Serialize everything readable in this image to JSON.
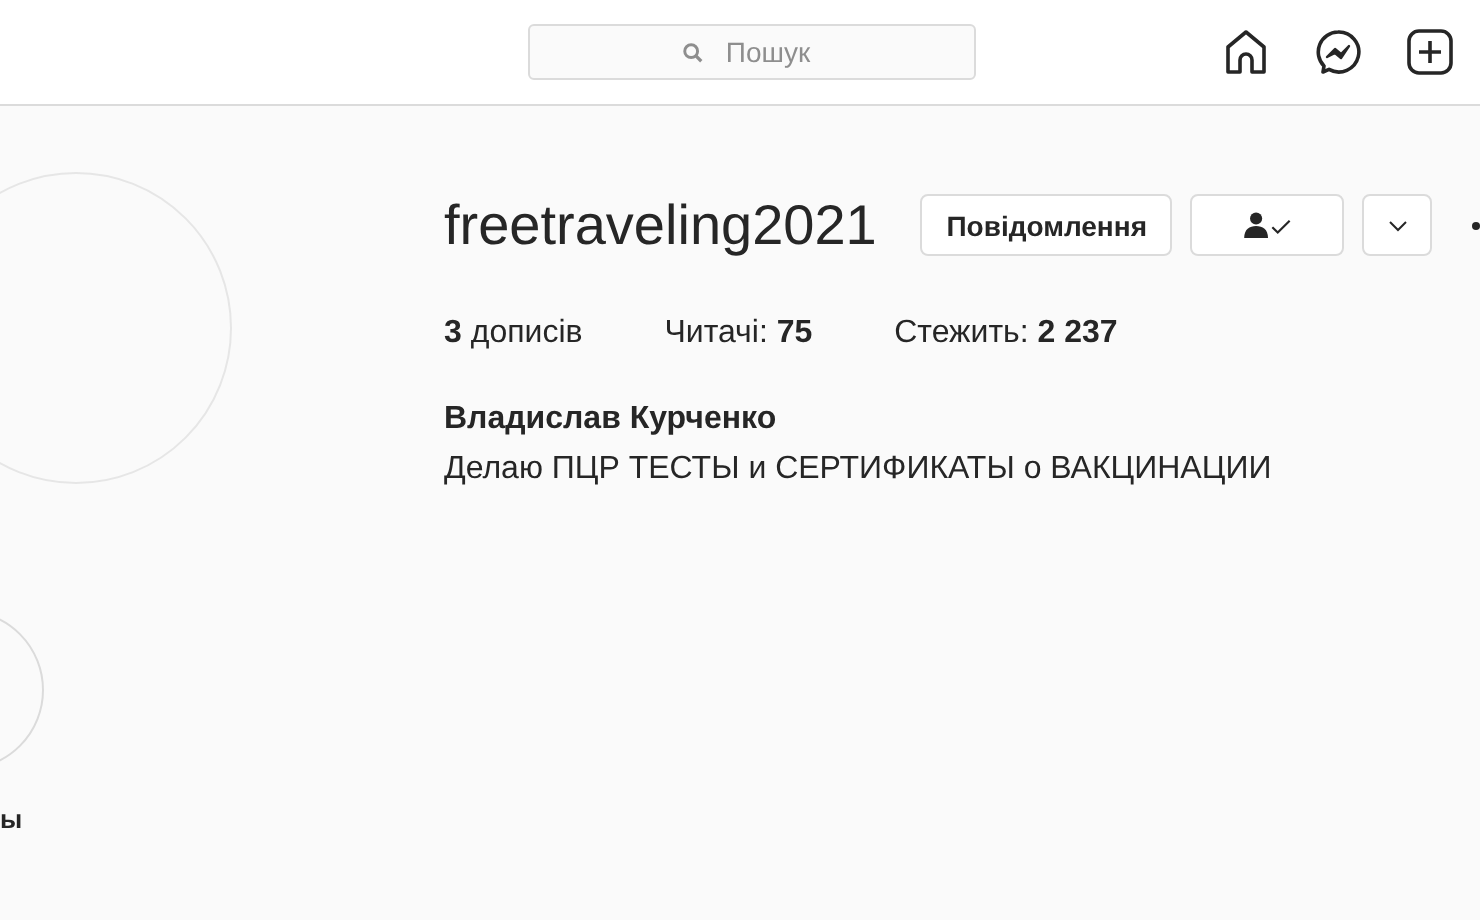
{
  "header": {
    "search": {
      "placeholder": "Пошук"
    }
  },
  "profile": {
    "username": "freetraveling2021",
    "buttons": [
      {
        "kind": "text",
        "label": "Повідомлення"
      },
      {
        "kind": "following"
      },
      {
        "kind": "dropdown"
      }
    ],
    "stats": [
      {
        "count": "3",
        "label": "дописів",
        "count_first": true
      },
      {
        "count": "75",
        "label": "Читачі:",
        "count_first": false
      },
      {
        "count": "2 237",
        "label": "Стежить:",
        "count_first": false
      }
    ],
    "full_name": "Владислав Курченко",
    "bio": "Делаю ПЦР ТЕСТЫ и СЕРТИФИКАТЫ о ВАКЦИНАЦИИ"
  },
  "highlights": [
    {
      "label": "ы"
    }
  ]
}
